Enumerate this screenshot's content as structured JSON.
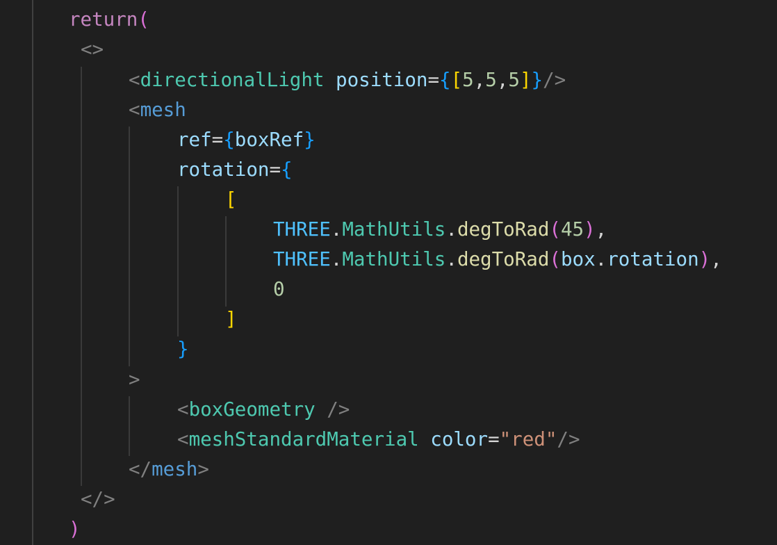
{
  "editor": {
    "language": "tsx",
    "theme_colors": {
      "background": "#1f1f1f",
      "keyword": "#c586c0",
      "tag": "#4ec9b0",
      "attribute": "#9cdcfe",
      "function": "#dcdcaa",
      "number": "#b5cea8",
      "string": "#ce9178",
      "bracket_level1": "#da70d6",
      "bracket_level2": "#179fff",
      "bracket_level3": "#ffd700"
    },
    "lines": [
      {
        "tokens": [
          "return",
          "("
        ]
      },
      {
        "tokens": [
          "<>"
        ]
      },
      {
        "tokens": [
          "<",
          "directionalLight",
          " ",
          "position",
          "=",
          "{",
          "[",
          "5",
          ",",
          "5",
          ",",
          "5",
          "]",
          "}",
          "/>"
        ]
      },
      {
        "tokens": [
          "<",
          "mesh"
        ]
      },
      {
        "tokens": [
          "ref",
          "=",
          "{",
          "boxRef",
          "}"
        ]
      },
      {
        "tokens": [
          "rotation",
          "=",
          "{"
        ]
      },
      {
        "tokens": [
          "["
        ]
      },
      {
        "tokens": [
          "THREE",
          ".",
          "MathUtils",
          ".",
          "degToRad",
          "(",
          "45",
          ")",
          ","
        ]
      },
      {
        "tokens": [
          "THREE",
          ".",
          "MathUtils",
          ".",
          "degToRad",
          "(",
          "box",
          ".",
          "rotation",
          ")",
          ","
        ]
      },
      {
        "tokens": [
          "0"
        ]
      },
      {
        "tokens": [
          "]"
        ]
      },
      {
        "tokens": [
          "}"
        ]
      },
      {
        "tokens": [
          ">"
        ]
      },
      {
        "tokens": [
          "<",
          "boxGeometry",
          " ",
          "/>"
        ]
      },
      {
        "tokens": [
          "<",
          "meshStandardMaterial",
          " ",
          "color",
          "=",
          "\"red\"",
          "/>"
        ]
      },
      {
        "tokens": [
          "</",
          "mesh",
          ">"
        ]
      },
      {
        "tokens": [
          "</>"
        ]
      },
      {
        "tokens": [
          ")"
        ]
      }
    ]
  }
}
